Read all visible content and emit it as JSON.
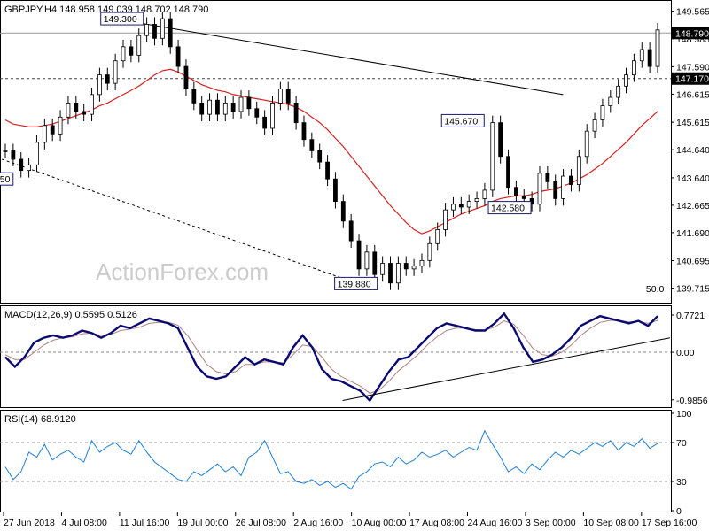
{
  "chart_data": [
    {
      "type": "candlestick",
      "title": "GBPJPY,H4  148.958 149.039 148.702 148.790",
      "watermark": "ActionForex.com",
      "ylim": [
        139.2,
        149.9
      ],
      "yticks": [
        "149.565",
        "148.585",
        "147.590",
        "146.615",
        "145.615",
        "144.640",
        "143.640",
        "142.665",
        "141.690",
        "140.695",
        "139.715"
      ],
      "ytick_values": [
        149.565,
        148.585,
        147.59,
        146.615,
        145.615,
        144.64,
        143.64,
        142.665,
        141.69,
        140.695,
        139.715
      ],
      "current_price": "148.790",
      "reference_level": "147.170",
      "annotations": [
        {
          "text": "149.300",
          "value": 149.3
        },
        {
          "text": "145.670",
          "value": 145.67
        },
        {
          "text": "142.580",
          "value": 142.58
        },
        {
          "text": "139.880",
          "value": 139.88
        },
        {
          "text": "50",
          "value": 143.6
        },
        {
          "text": "50.0",
          "value": 139.7
        }
      ],
      "close_series": [
        144.6,
        144.3,
        143.9,
        144.1,
        144.9,
        145.5,
        145.2,
        145.8,
        146.3,
        146.0,
        145.9,
        146.6,
        147.3,
        147.0,
        147.8,
        148.3,
        148.0,
        148.7,
        149.1,
        148.6,
        149.3,
        148.3,
        147.6,
        146.8,
        146.3,
        145.9,
        146.4,
        145.9,
        146.3,
        146.0,
        146.5,
        146.1,
        145.8,
        145.4,
        146.3,
        146.8,
        146.3,
        145.6,
        145.0,
        144.6,
        144.2,
        143.6,
        142.8,
        142.1,
        141.4,
        140.4,
        141.0,
        140.2,
        140.6,
        139.9,
        140.6,
        140.4,
        140.5,
        140.7,
        141.3,
        141.8,
        142.5,
        142.7,
        142.6,
        142.8,
        142.9,
        143.2,
        145.6,
        144.4,
        143.3,
        143.0,
        142.9,
        142.7,
        143.8,
        143.5,
        142.9,
        143.7,
        143.4,
        144.4,
        145.3,
        145.7,
        146.2,
        146.5,
        146.9,
        147.3,
        147.8,
        148.2,
        147.6,
        148.9
      ],
      "ma_series": [
        145.7,
        145.55,
        145.5,
        145.45,
        145.45,
        145.5,
        145.55,
        145.65,
        145.75,
        145.85,
        145.95,
        146.05,
        146.2,
        146.3,
        146.45,
        146.6,
        146.75,
        146.9,
        147.1,
        147.3,
        147.45,
        147.5,
        147.4,
        147.25,
        147.1,
        146.95,
        146.85,
        146.75,
        146.7,
        146.6,
        146.55,
        146.5,
        146.45,
        146.4,
        146.35,
        146.3,
        146.25,
        146.15,
        146.0,
        145.8,
        145.6,
        145.35,
        145.05,
        144.75,
        144.4,
        144.05,
        143.7,
        143.35,
        143.0,
        142.65,
        142.35,
        142.05,
        141.8,
        141.65,
        141.75,
        141.9,
        142.05,
        142.2,
        142.35,
        142.45,
        142.55,
        142.65,
        142.8,
        142.9,
        142.95,
        143.0,
        143.0,
        143.05,
        143.15,
        143.2,
        143.25,
        143.35,
        143.45,
        143.6,
        143.75,
        143.95,
        144.15,
        144.4,
        144.65,
        144.9,
        145.2,
        145.5,
        145.75,
        146.0
      ],
      "trendlines": [
        {
          "from": [
            0.18,
            149.25
          ],
          "to": [
            0.84,
            146.6
          ],
          "style": "solid"
        },
        {
          "from": [
            0.0,
            144.3
          ],
          "to": [
            0.53,
            139.9
          ],
          "style": "dashed"
        }
      ],
      "xlabels": [
        "27 Jun 2018",
        "4 Jul 08:00",
        "11 Jul 16:00",
        "19 Jul 00:00",
        "26 Jul 08:00",
        "2 Aug 16:00",
        "10 Aug 00:00",
        "17 Aug 08:00",
        "24 Aug 16:00",
        "3 Sep 00:00",
        "10 Sep 08:00",
        "17 Sep 16:00"
      ]
    },
    {
      "type": "line",
      "title": "MACD(12,26,9) 0.5595 0.5126",
      "ylim": [
        -1.1,
        0.9
      ],
      "yticks": [
        "0.7721",
        "0.00",
        "-0.9856"
      ],
      "ytick_values": [
        0.7721,
        0.0,
        -0.9856
      ],
      "series": [
        {
          "values": [
            -0.1,
            -0.3,
            -0.1,
            0.2,
            0.3,
            0.35,
            0.3,
            0.35,
            0.45,
            0.4,
            0.3,
            0.4,
            0.55,
            0.5,
            0.6,
            0.7,
            0.65,
            0.6,
            0.5,
            0.1,
            -0.3,
            -0.5,
            -0.55,
            -0.5,
            -0.3,
            -0.1,
            -0.25,
            -0.15,
            -0.2,
            -0.25,
            0.1,
            0.35,
            0.1,
            -0.35,
            -0.55,
            -0.6,
            -0.7,
            -0.8,
            -1.0,
            -0.7,
            -0.4,
            -0.15,
            -0.1,
            0.1,
            0.3,
            0.5,
            0.6,
            0.55,
            0.5,
            0.45,
            0.45,
            0.6,
            0.8,
            0.5,
            0.1,
            -0.2,
            -0.15,
            -0.05,
            0.1,
            0.3,
            0.55,
            0.65,
            0.75,
            0.7,
            0.65,
            0.6,
            0.65,
            0.55,
            0.75
          ]
        },
        {
          "values": [
            -0.05,
            -0.15,
            -0.15,
            0.0,
            0.15,
            0.25,
            0.3,
            0.32,
            0.38,
            0.4,
            0.35,
            0.37,
            0.45,
            0.48,
            0.52,
            0.6,
            0.62,
            0.62,
            0.56,
            0.35,
            0.05,
            -0.25,
            -0.4,
            -0.45,
            -0.4,
            -0.25,
            -0.25,
            -0.2,
            -0.2,
            -0.22,
            -0.05,
            0.15,
            0.12,
            -0.1,
            -0.35,
            -0.5,
            -0.6,
            -0.7,
            -0.85,
            -0.78,
            -0.6,
            -0.38,
            -0.22,
            -0.05,
            0.15,
            0.32,
            0.45,
            0.5,
            0.5,
            0.47,
            0.46,
            0.52,
            0.65,
            0.58,
            0.35,
            0.08,
            -0.05,
            -0.08,
            0.0,
            0.15,
            0.35,
            0.5,
            0.62,
            0.66,
            0.66,
            0.63,
            0.64,
            0.6,
            0.66
          ]
        }
      ],
      "trendline": {
        "from": [
          0.51,
          -1.0
        ],
        "to": [
          1.0,
          0.3
        ]
      }
    },
    {
      "type": "line",
      "title": "RSI(14) 68.9120",
      "ylim": [
        0,
        100
      ],
      "yticks": [
        "100",
        "70",
        "30",
        "0"
      ],
      "ytick_values": [
        100,
        70,
        30,
        0
      ],
      "series": [
        {
          "values": [
            45,
            32,
            40,
            60,
            55,
            68,
            52,
            58,
            62,
            55,
            50,
            72,
            60,
            66,
            70,
            62,
            58,
            72,
            60,
            50,
            44,
            38,
            32,
            30,
            40,
            36,
            42,
            48,
            40,
            45,
            36,
            55,
            60,
            72,
            55,
            38,
            40,
            30,
            28,
            32,
            26,
            30,
            24,
            28,
            22,
            35,
            40,
            48,
            50,
            45,
            55,
            48,
            52,
            60,
            55,
            58,
            62,
            55,
            60,
            65,
            62,
            82,
            68,
            55,
            40,
            45,
            38,
            48,
            42,
            52,
            60,
            55,
            62,
            58,
            64,
            70,
            66,
            72,
            62,
            70,
            66,
            74,
            64,
            69
          ]
        }
      ]
    }
  ]
}
